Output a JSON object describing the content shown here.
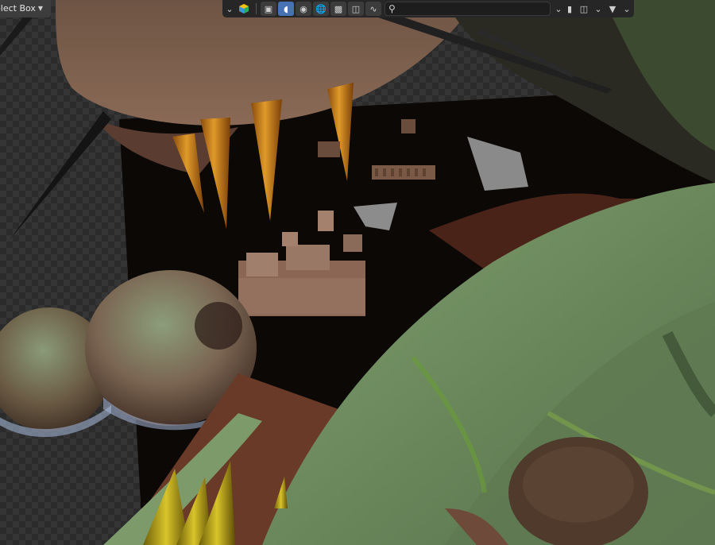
{
  "app": {
    "header": {
      "select_mode_label": "elect Box",
      "search": {
        "value": "",
        "placeholder": ""
      },
      "icons": [
        "chevron-down-icon",
        "render-engine-sphere-icon",
        "object-mode-icon",
        "viewport-shading-icon",
        "material-icon",
        "world-icon",
        "paint-icon",
        "overlay-icon",
        "node-icon",
        "search-icon",
        "bookmark-icon",
        "layout-icon",
        "filter-icon"
      ]
    },
    "viewport": {
      "background_checker_dark": "#2b2b2b",
      "background_checker_light": "#353535",
      "colors": {
        "skin_green": "#6d8a5e",
        "skin_brown": "#7b5a46",
        "teeth_orange": "#d08a1e",
        "spike_yellow": "#c9b21c",
        "shadow": "#0b0806"
      }
    }
  }
}
